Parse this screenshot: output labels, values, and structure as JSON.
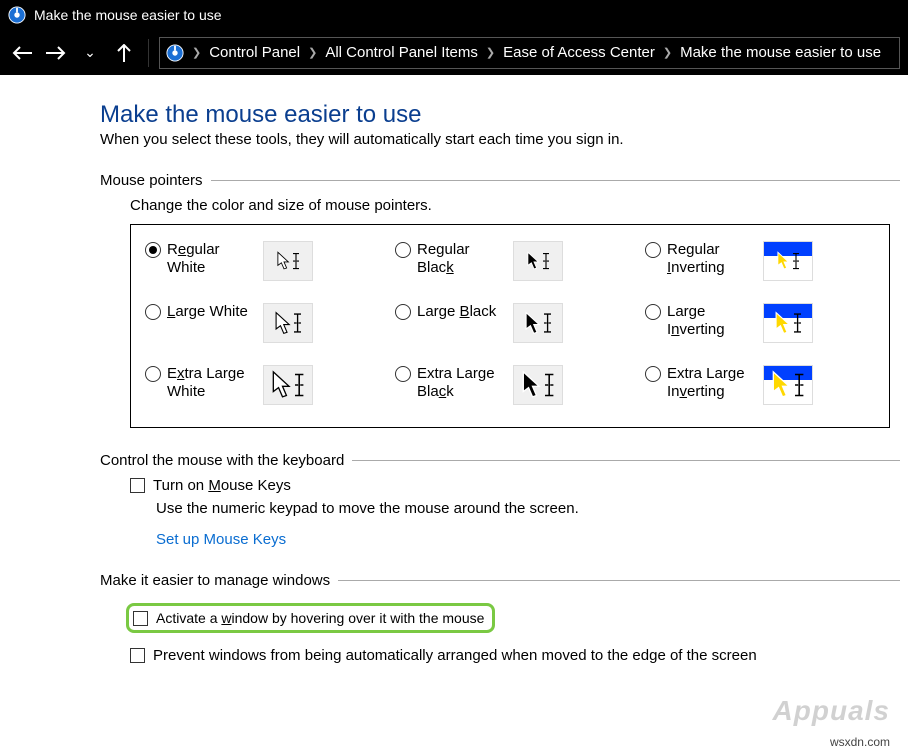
{
  "window": {
    "title": "Make the mouse easier to use"
  },
  "breadcrumbs": [
    "Control Panel",
    "All Control Panel Items",
    "Ease of Access Center",
    "Make the mouse easier to use"
  ],
  "page": {
    "title": "Make the mouse easier to use",
    "subtitle": "When you select these tools, they will automatically start each time you sign in."
  },
  "pointers": {
    "section": "Mouse pointers",
    "desc": "Change the color and size of mouse pointers.",
    "options": [
      {
        "label_pre": "R",
        "ul": "e",
        "label_post": "gular White",
        "selected": true,
        "style": "white",
        "size": "s"
      },
      {
        "label_pre": "Regular Blac",
        "ul": "k",
        "label_post": "",
        "selected": false,
        "style": "black",
        "size": "s"
      },
      {
        "label_pre": "Regular ",
        "ul": "I",
        "label_post": "nverting",
        "selected": false,
        "style": "inverting",
        "size": "s"
      },
      {
        "label_pre": "",
        "ul": "L",
        "label_post": "arge White",
        "selected": false,
        "style": "white",
        "size": "m"
      },
      {
        "label_pre": "Large ",
        "ul": "B",
        "label_post": "lack",
        "selected": false,
        "style": "black",
        "size": "m"
      },
      {
        "label_pre": "Large I",
        "ul": "n",
        "label_post": "verting",
        "selected": false,
        "style": "inverting",
        "size": "m"
      },
      {
        "label_pre": "E",
        "ul": "x",
        "label_post": "tra Large White",
        "selected": false,
        "style": "white",
        "size": "l"
      },
      {
        "label_pre": "Extra Large Bla",
        "ul": "c",
        "label_post": "k",
        "selected": false,
        "style": "black",
        "size": "l"
      },
      {
        "label_pre": "Extra Large In",
        "ul": "v",
        "label_post": "erting",
        "selected": false,
        "style": "inverting",
        "size": "l"
      }
    ]
  },
  "keyboard": {
    "section": "Control the mouse with the keyboard",
    "check_pre": "Turn on ",
    "check_ul": "M",
    "check_post": "ouse Keys",
    "desc": "Use the numeric keypad to move the mouse around the screen.",
    "link": "Set up Mouse Keys"
  },
  "windows": {
    "section": "Make it easier to manage windows",
    "hover_pre": "Activate a ",
    "hover_ul": "w",
    "hover_post": "indow by hovering over it with the mouse",
    "prevent": "Prevent windows from being automatically arranged when moved to the edge of the screen"
  },
  "watermark": "Appuals",
  "sourceurl": "wsxdn.com"
}
